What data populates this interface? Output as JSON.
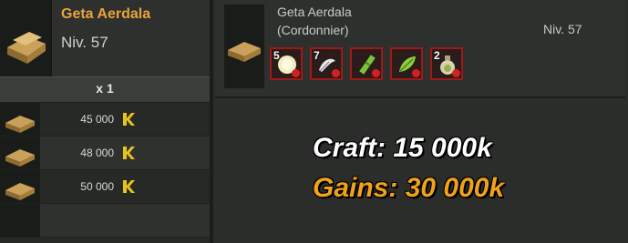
{
  "item": {
    "name": "Geta Aerdala",
    "level": "Niv. 57",
    "quantity": "x 1"
  },
  "prices": [
    {
      "price": "45 000",
      "currency_icon": "kamas-icon"
    },
    {
      "price": "48 000",
      "currency_icon": "kamas-icon"
    },
    {
      "price": "50 000",
      "currency_icon": "kamas-icon"
    }
  ],
  "recipe": {
    "name": "Geta Aerdala",
    "job": "(Cordonnier)",
    "level": "Niv. 57",
    "ingredients": [
      {
        "count": "5",
        "icon": "round-ingredient-icon"
      },
      {
        "count": "7",
        "icon": "feather-ingredient-icon"
      },
      {
        "count": "",
        "icon": "bamboo-ingredient-icon"
      },
      {
        "count": "",
        "icon": "leaf-ingredient-icon"
      },
      {
        "count": "2",
        "icon": "potion-ingredient-icon"
      }
    ]
  },
  "overlay": {
    "craft": "Craft: 15 000k",
    "gains": "Gains: 30 000k"
  },
  "colors": {
    "accent_orange": "#e9a33c",
    "missing_red": "#a01818",
    "gains_orange": "#f1a21b"
  }
}
